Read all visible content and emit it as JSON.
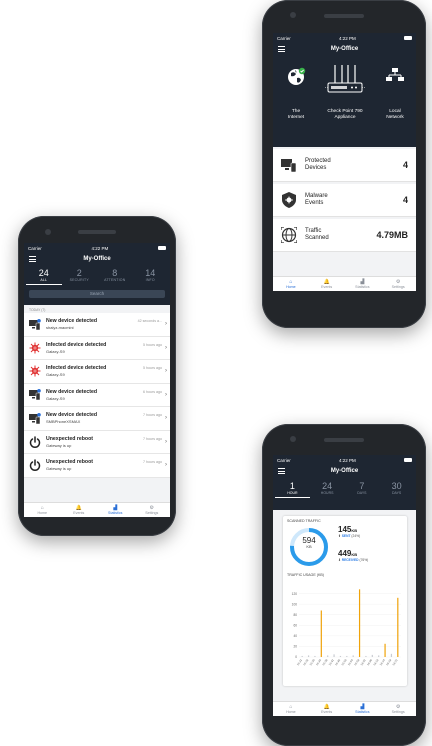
{
  "colors": {
    "header": "#1e2632",
    "accent": "#2a6fd6",
    "ring": "#2b9bea",
    "bar": "#f0a30a",
    "danger": "#e03131"
  },
  "status": {
    "carrier": "Carrier",
    "time": "4:22 PM"
  },
  "app_title": "My-Office",
  "events_screen": {
    "tabs": [
      {
        "count": "24",
        "label": "ALL"
      },
      {
        "count": "2",
        "label": "SECURITY"
      },
      {
        "count": "8",
        "label": "ATTENTION"
      },
      {
        "count": "14",
        "label": "INFO"
      }
    ],
    "search_placeholder": "Search",
    "section_label": "TODAY (7)",
    "events": [
      {
        "title": "New device detected",
        "subtitle": "shaiyz-macmini",
        "time": "42 seconds a...",
        "icon": "device-icon"
      },
      {
        "title": "Infected device detected",
        "subtitle": "Galaxy-S9",
        "time": "5 hours ago",
        "icon": "virus-icon"
      },
      {
        "title": "Infected device detected",
        "subtitle": "Galaxy-S9",
        "time": "5 hours ago",
        "icon": "virus-icon"
      },
      {
        "title": "New device detected",
        "subtitle": "Galaxy-S9",
        "time": "6 hours ago",
        "icon": "device-icon"
      },
      {
        "title": "New device detected",
        "subtitle": "SMBPhoneXSMAX",
        "time": "7 hours ago",
        "icon": "device-icon"
      },
      {
        "title": "Unexpected reboot",
        "subtitle": "Gateway is up",
        "time": "7 hours ago",
        "icon": "power-icon"
      },
      {
        "title": "Unexpected reboot",
        "subtitle": "Gateway is up",
        "time": "7 hours ago",
        "icon": "power-icon"
      }
    ],
    "nav": [
      "Home",
      "Events",
      "Statistics",
      "Settings"
    ]
  },
  "home_screen": {
    "hero_labels": {
      "internet": "The\nInternet",
      "appliance": "Check Point 790\nAppliance",
      "local": "Local\nNetwork"
    },
    "cards": [
      {
        "label": "Protected\nDevices",
        "value": "4"
      },
      {
        "label": "Malware\nEvents",
        "value": "4"
      },
      {
        "label": "Traffic\nScanned",
        "value": "4.79MB"
      }
    ],
    "nav": [
      "Home",
      "Events",
      "Statistics",
      "Settings"
    ]
  },
  "stats_screen": {
    "tabs": [
      {
        "count": "1",
        "label": "HOUR"
      },
      {
        "count": "24",
        "label": "HOURS"
      },
      {
        "count": "7",
        "label": "DAYS"
      },
      {
        "count": "30",
        "label": "DAYS"
      }
    ],
    "scanned_title": "SCANNED TRAFFIC",
    "total": {
      "value": "594",
      "unit": "KB"
    },
    "sent": {
      "value": "145",
      "unit": "KB",
      "label": "SENT",
      "pct": "(24%)"
    },
    "received": {
      "value": "449",
      "unit": "KB",
      "label": "RECEIVED",
      "pct": "(76%)"
    },
    "sent_fraction": 0.24,
    "usage_title": "TRAFFIC USAGE (KB)",
    "nav": [
      "Home",
      "Events",
      "Statistics",
      "Settings"
    ]
  },
  "chart_data": {
    "type": "bar",
    "title": "TRAFFIC USAGE (KB)",
    "xlabel": "",
    "ylabel": "",
    "ylim": [
      0,
      140
    ],
    "y_ticks": [
      0,
      20,
      40,
      60,
      80,
      100,
      120
    ],
    "categories": [
      "15:22",
      "15:26",
      "15:30",
      "15:34",
      "15:38",
      "15:42",
      "15:46",
      "15:50",
      "15:54",
      "15:58",
      "16:02",
      "16:06",
      "16:10",
      "16:14",
      "16:18",
      "16:22"
    ],
    "series": [
      {
        "values": [
          2,
          3,
          2,
          88,
          3,
          5,
          2,
          2,
          3,
          128,
          2,
          4,
          3,
          25,
          6,
          112
        ]
      }
    ]
  }
}
